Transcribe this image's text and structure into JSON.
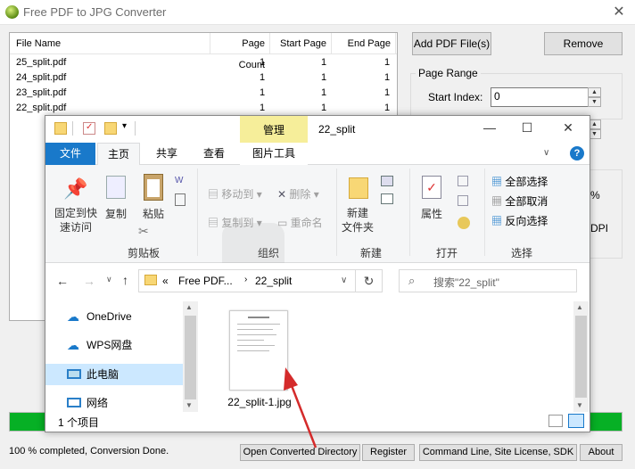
{
  "app": {
    "title": "Free PDF to JPG Converter",
    "columns": [
      "File Name",
      "Page Count",
      "Start Page",
      "End Page"
    ],
    "files": [
      {
        "name": "25_split.pdf",
        "pages": "1",
        "start": "1",
        "end": "1"
      },
      {
        "name": "24_split.pdf",
        "pages": "1",
        "start": "1",
        "end": "1"
      },
      {
        "name": "23_split.pdf",
        "pages": "1",
        "start": "1",
        "end": "1"
      },
      {
        "name": "22_split.pdf",
        "pages": "1",
        "start": "1",
        "end": "1"
      }
    ],
    "add_button": "Add PDF File(s)",
    "remove_button": "Remove",
    "page_range_label": "Page Range",
    "start_index_label": "Start Index:",
    "start_index_value": "0",
    "partial_label_1": "%",
    "partial_label_2": "DPI",
    "progress": 100,
    "progress_color": "#06b025",
    "status": "100 % completed, Conversion Done.",
    "bottom_buttons": {
      "open_dir": "Open Converted Directory",
      "register": "Register",
      "command": "Command Line, Site License, SDK",
      "about": "About"
    }
  },
  "explorer": {
    "title": "22_split",
    "manage_tab": "管理",
    "picture_tools_tab": "图片工具",
    "tabs": {
      "file": "文件",
      "home": "主页",
      "share": "共享",
      "view": "查看"
    },
    "ribbon": {
      "pin": "固定到快\n速访问",
      "copy": "复制",
      "paste": "粘贴",
      "clipboard_group": "剪贴板",
      "move_to": "移动到",
      "delete": "删除",
      "copy_to": "复制到",
      "rename": "重命名",
      "organize_group": "组织",
      "new_folder": "新建\n文件夹",
      "new_group": "新建",
      "properties": "属性",
      "open_group": "打开",
      "select_all": "全部选择",
      "select_none": "全部取消",
      "invert_select": "反向选择",
      "select_group": "选择"
    },
    "address": {
      "prefix": "«",
      "seg1": "Free PDF...",
      "seg2": "22_split"
    },
    "search_placeholder": "搜索\"22_split\"",
    "nav_items": {
      "onedrive": "OneDrive",
      "wps": "WPS网盘",
      "pc": "此电脑",
      "network": "网络"
    },
    "file_name": "22_split-1.jpg",
    "item_count": "1 个项目",
    "accent": "#1979ca",
    "selected_bg": "#cce8ff"
  },
  "annotation": {
    "arrow_color": "#d42b2b"
  }
}
